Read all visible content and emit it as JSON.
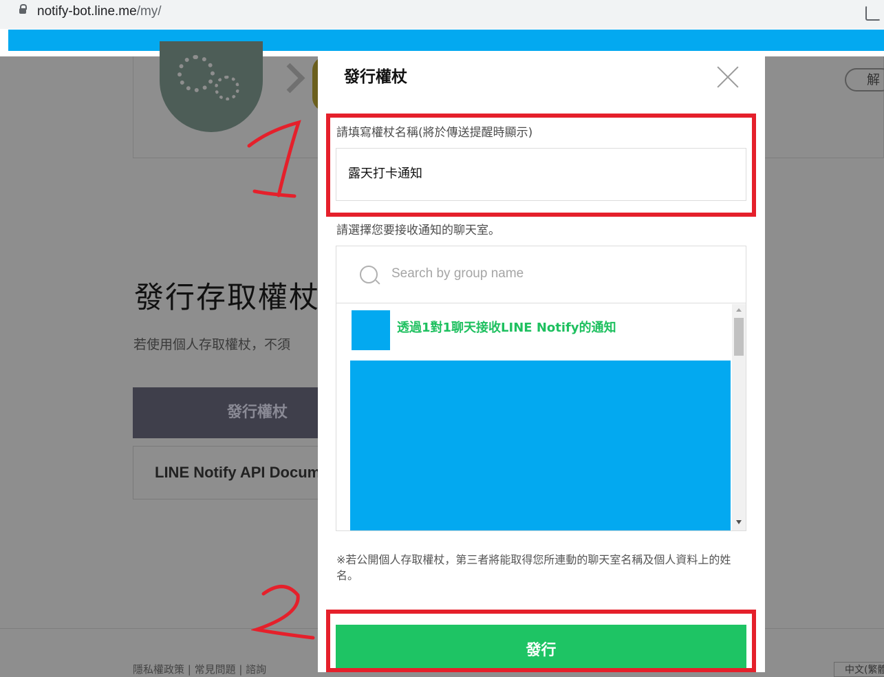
{
  "browser": {
    "url_host": "notify-bot.line.me",
    "url_path": "/my/"
  },
  "background": {
    "heading": "發行存取權杖",
    "subtext": "若使用個人存取權杖，不須",
    "pill_button": "解除",
    "issue_button": "發行權杖",
    "doc_button": "LINE Notify API Document",
    "footer": "隱私權政策 | 常見問題 | 諮詢",
    "language": "中文(繁體)"
  },
  "modal": {
    "title": "發行權杖",
    "name_label": "請填寫權杖名稱(將於傳送提醒時顯示)",
    "name_value": "露天打卡通知",
    "chat_label": "請選擇您要接收通知的聊天室。",
    "search_placeholder": "Search by group name",
    "chat_items": [
      {
        "label": "透過1對1聊天接收LINE Notify的通知",
        "color": "#1ec05f"
      }
    ],
    "notice": "※若公開個人存取權杖，第三者將能取得您所連動的聊天室名稱及個人資料上的姓名。",
    "issue_button": "發行"
  },
  "colors": {
    "accent_green": "#1ec464",
    "redaction_blue": "#03a9f0",
    "annotation_red": "#e5202b"
  },
  "annotations": {
    "step1": "1",
    "step2": "2"
  }
}
